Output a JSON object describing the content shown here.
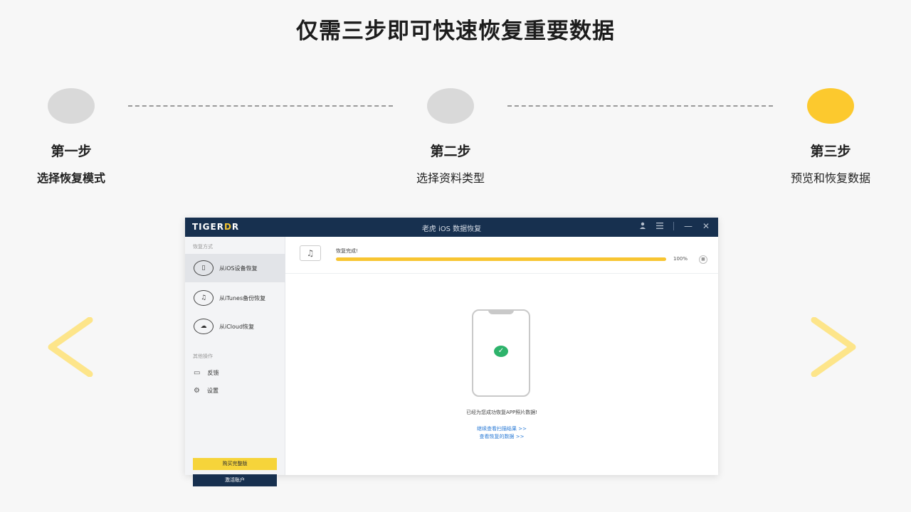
{
  "page": {
    "title": "仅需三步即可快速恢复重要数据"
  },
  "steps": [
    {
      "name": "第一步",
      "desc": "选择恢复模式",
      "active": false
    },
    {
      "name": "第二步",
      "desc": "选择资料类型",
      "active": false
    },
    {
      "name": "第三步",
      "desc": "预览和恢复数据",
      "active": true
    }
  ],
  "carousel": {
    "prev_icon": "chevron-left-icon",
    "next_icon": "chevron-right-icon",
    "accent": "#fcc92e"
  },
  "app": {
    "logo_prefix": "TIGER",
    "logo_accent": "D",
    "logo_suffix": "R",
    "window_title": "老虎 iOS 数据恢复",
    "controls": {
      "user": "user-icon",
      "menu": "menu-icon",
      "minimize": "—",
      "close": "✕"
    },
    "sidebar": {
      "recover_heading": "恢复方式",
      "modes": [
        {
          "label": "从iOS设备恢复",
          "icon": "phone-icon",
          "glyph": "▯",
          "active": true
        },
        {
          "label": "从iTunes备份恢复",
          "icon": "music-icon",
          "glyph": "♫",
          "active": false
        },
        {
          "label": "从iCloud恢复",
          "icon": "cloud-icon",
          "glyph": "☁",
          "active": false
        }
      ],
      "other_heading": "其他操作",
      "others": [
        {
          "label": "反馈",
          "icon": "feedback-icon",
          "glyph": "▭"
        },
        {
          "label": "设置",
          "icon": "gear-icon",
          "glyph": "⚙"
        }
      ],
      "buy_label": "购买完整版",
      "activate_label": "激活账户"
    },
    "main": {
      "status_text": "恢复完成!",
      "progress_percent": 100,
      "progress_label": "100%",
      "message": "已经为您成功恢复APP照片数据!",
      "link_scan": "继续查看扫描结果 >>",
      "link_view": "查看恢复的数据 >>"
    },
    "colors": {
      "titlebar": "#17304f",
      "progress": "#f8c531",
      "success": "#2db36b",
      "link": "#2b7bd6"
    }
  }
}
